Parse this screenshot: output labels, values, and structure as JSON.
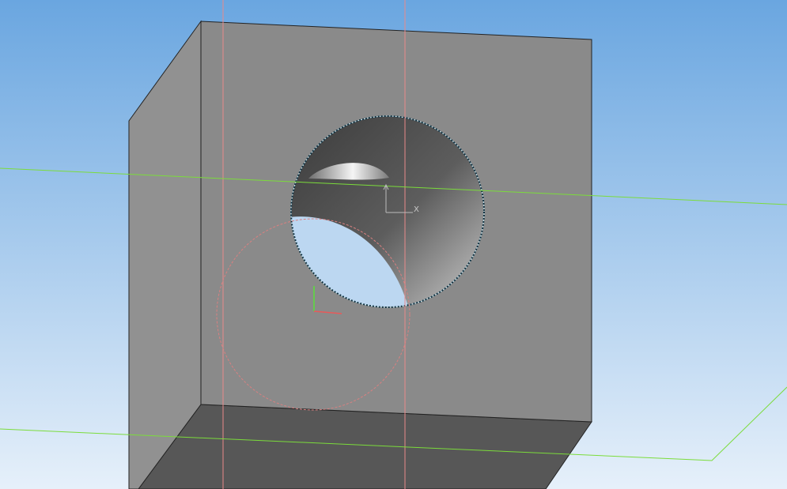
{
  "viewport": {
    "background_top": "#6aa6e0",
    "background_bottom": "#e6f0fa"
  },
  "model": {
    "face_color": "#8a8a8a",
    "side_color": "#919191",
    "bottom_color": "#575757",
    "edge_color": "#222222"
  },
  "construction_lines": {
    "vertical_color": "#e88a8a",
    "plane_color": "#7bdc3b",
    "circle_color": "#d98080"
  },
  "origin_triad": {
    "x_label": "X",
    "y_label": ""
  }
}
